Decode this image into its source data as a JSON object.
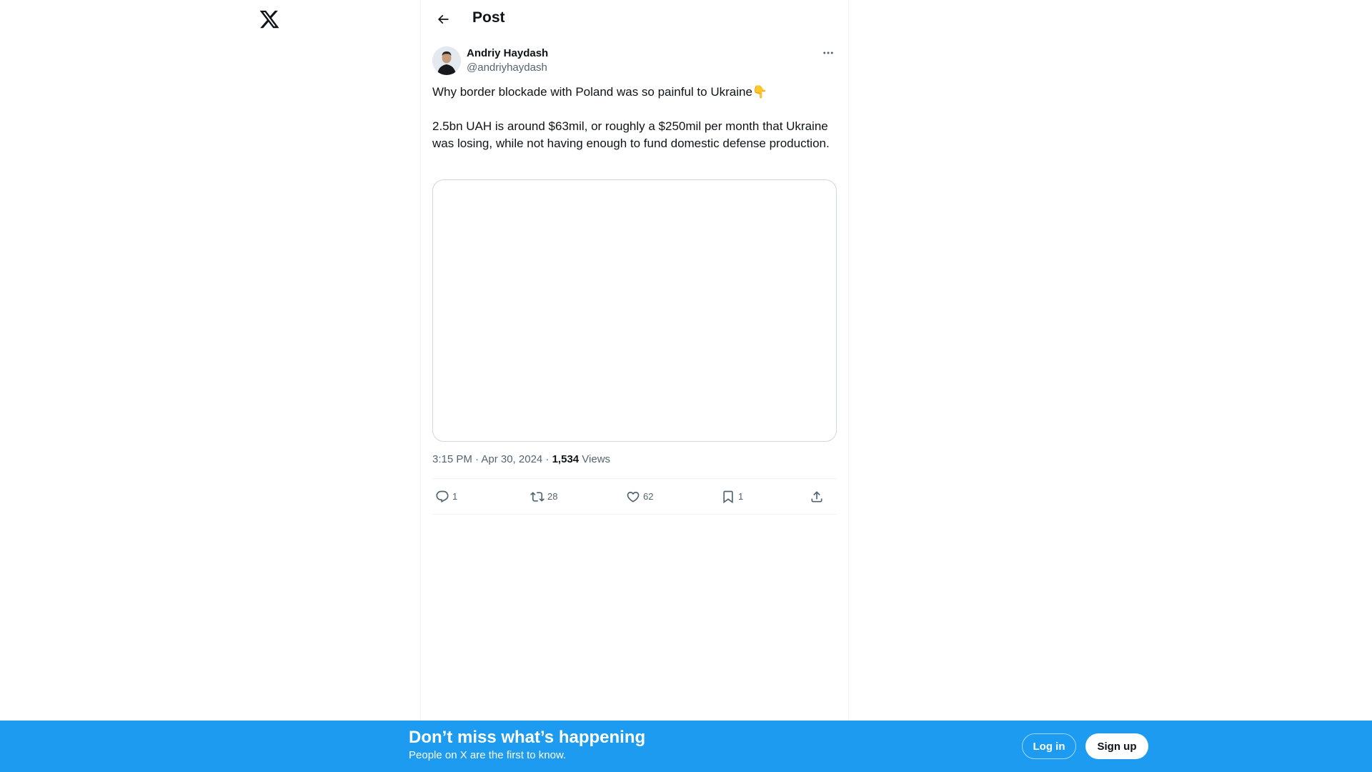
{
  "header": {
    "title": "Post"
  },
  "tweet": {
    "author_name": "Andriy Haydash",
    "author_handle": "@andriyhaydash",
    "paragraph_1": "Why border blockade with Poland was so painful to Ukraine👇",
    "paragraph_2": "2.5bn UAH is around $63mil, or roughly a $250mil per month that Ukraine was losing, while not having enough to fund domestic defense production.",
    "time": "3:15 PM · Apr 30, 2024 · ",
    "views_count": "1,534",
    "views_label": " Views"
  },
  "actions": {
    "replies": "1",
    "reposts": "28",
    "likes": "62",
    "bookmarks": "1"
  },
  "banner": {
    "title": "Don’t miss what’s happening",
    "subtitle": "People on X are the first to know.",
    "login_label": "Log in",
    "signup_label": "Sign up"
  },
  "icons": {
    "logo": "x-logo-icon",
    "back": "arrow-left-icon",
    "more": "more-horizontal-icon",
    "reply": "reply-icon",
    "repost": "repost-icon",
    "like": "heart-icon",
    "bookmark": "bookmark-icon",
    "share": "share-icon"
  },
  "colors": {
    "accent": "#1d9bf0",
    "text": "#0f1419",
    "secondary": "#536471",
    "border": "#eff3f4"
  }
}
